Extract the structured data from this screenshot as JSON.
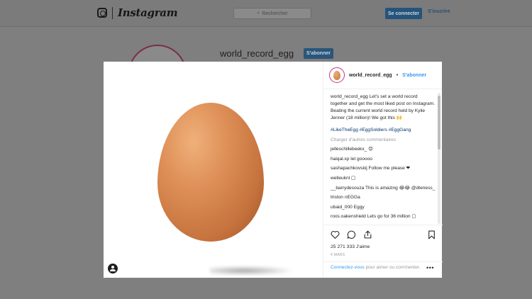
{
  "topbar": {
    "wordmark": "Instagram",
    "search_placeholder": "Rechercher",
    "login_label": "Se connecter",
    "signup_label": "S'inscrire"
  },
  "profile": {
    "username": "world_record_egg",
    "follow_label": "S'abonner"
  },
  "post": {
    "username": "world_record_egg",
    "separator": "•",
    "follow_label": "S'abonner",
    "caption_user": "world_record_egg",
    "caption_text": "Let's set a world record together and get the most liked post on Instagram. Beating the current world record held by Kylie Jenner (18 million)! We got this 🙌",
    "hashtags": "#LikeTheEgg #EggSoldiers #EggGang",
    "more_comments": "Charger d'autres commentaires",
    "comments": [
      {
        "user": "jelleschillebeekx_",
        "text": "😍"
      },
      {
        "user": "haiqal.xp",
        "text": "let gooooo"
      },
      {
        "user": "sashapachkovskij",
        "text": "Follow me please ❤"
      },
      {
        "user": "welleuknl",
        "text": "▢"
      },
      {
        "user": "__barrydesouza",
        "text": "This is amazing 😂😂 @dteness_"
      },
      {
        "user": "triston",
        "text": "nEGGa"
      },
      {
        "user": "ubaid_000",
        "text": "Eggy"
      },
      {
        "user": "roos.oakenshield",
        "text": "Lets go for 36 million ▢"
      }
    ],
    "likes": "25 271 333 J'aime",
    "time_ago": "4 MARS",
    "login_prompt_link": "Connectez-vous",
    "login_prompt_rest": " pour aimer ou commenter.",
    "more_options": "•••"
  },
  "colors": {
    "link_blue": "#3897f0",
    "hashtag_blue": "#003569",
    "avatar_ring": "#c13584"
  },
  "icons": {
    "logo": "instagram-glyph-icon",
    "search": "search-icon",
    "like": "heart-icon",
    "comment": "comment-bubble-icon",
    "share": "share-icon",
    "save": "bookmark-icon",
    "user_tag": "user-tag-icon"
  }
}
